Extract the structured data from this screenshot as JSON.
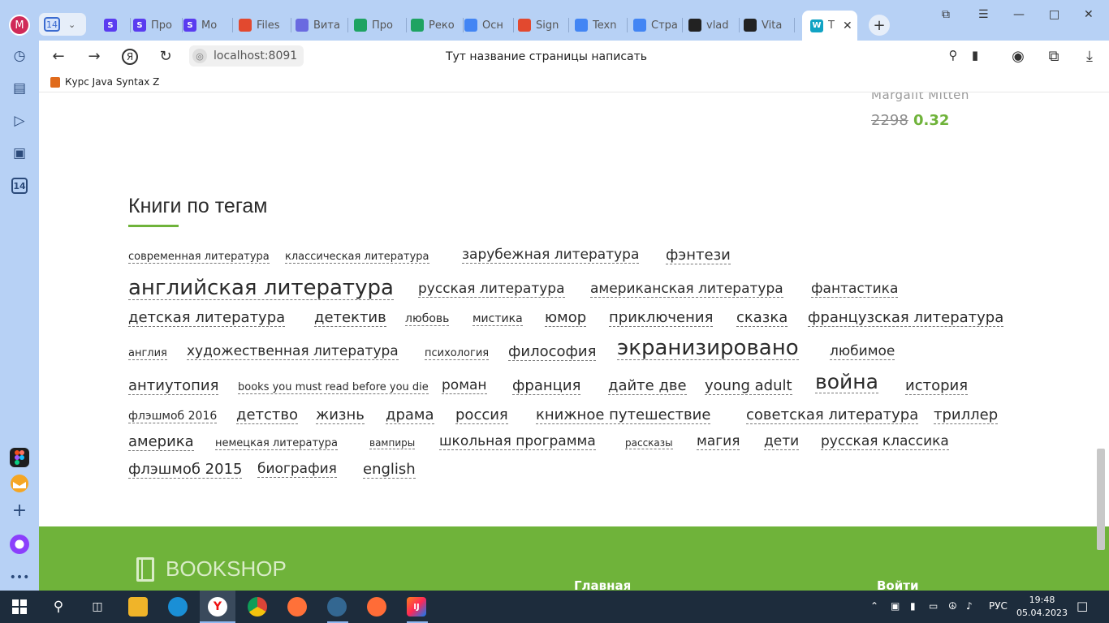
{
  "sidebar": {
    "profile_letter": "M",
    "badge": "14"
  },
  "tabs": {
    "group_count": "14",
    "items": [
      {
        "label": "",
        "icon_letter": "S",
        "color": "#5a3cf0"
      },
      {
        "label": "Про",
        "icon_letter": "S",
        "color": "#5a3cf0"
      },
      {
        "label": "Мо",
        "icon_letter": "S",
        "color": "#5a3cf0"
      },
      {
        "label": "Files",
        "icon_letter": "",
        "color": "#e2492f"
      },
      {
        "label": "Вита",
        "icon_letter": "",
        "color": "#6a6ae0"
      },
      {
        "label": "Про",
        "icon_letter": "",
        "color": "#1ea362"
      },
      {
        "label": "Реко",
        "icon_letter": "",
        "color": "#1ea362"
      },
      {
        "label": "Осн",
        "icon_letter": "",
        "color": "#4285f4"
      },
      {
        "label": "Sign",
        "icon_letter": "",
        "color": "#e2492f"
      },
      {
        "label": "Texn",
        "icon_letter": "",
        "color": "#4285f4"
      },
      {
        "label": "Стра",
        "icon_letter": "",
        "color": "#4285f4"
      },
      {
        "label": "vlad",
        "icon_letter": "",
        "color": "#222"
      },
      {
        "label": "Vita",
        "icon_letter": "",
        "color": "#222"
      }
    ],
    "active_label": "T",
    "active_icon": "W"
  },
  "nav": {
    "url": "localhost:8091",
    "title": "Тут название страницы написать"
  },
  "bookmarks": [
    {
      "label": "Курс Java Syntax Z"
    }
  ],
  "book": {
    "author": "Margalit Mitten",
    "old_price": "2298",
    "new_price": "0.32"
  },
  "section": {
    "title": "Книги по тегам"
  },
  "tags": [
    "современная литература",
    "классическая литература",
    "зарубежная литература",
    "фэнтези",
    "английская литература",
    "русская литература",
    "американская литература",
    "фантастика",
    "детская литература",
    "детектив",
    "любовь",
    "мистика",
    "юмор",
    "приключения",
    "сказка",
    "французская литература",
    "англия",
    "художественная литература",
    "психология",
    "философия",
    "экранизировано",
    "любимое",
    "антиутопия",
    "books you must read before you die",
    "роман",
    "франция",
    "дайте две",
    "young adult",
    "война",
    "история",
    "флэшмоб 2016",
    "детство",
    "жизнь",
    "драма",
    "россия",
    "книжное путешествие",
    "советская литература",
    "триллер",
    "америка",
    "немецкая литература",
    "вампиры",
    "школьная программа",
    "рассказы",
    "магия",
    "дети",
    "русская классика",
    "флэшмоб 2015",
    "биография",
    "english"
  ],
  "footer": {
    "logo": "BOOKSHOP",
    "link_main": "Главная",
    "link_login": "Войти"
  },
  "taskbar": {
    "lang": "РУС",
    "time": "19:48",
    "date": "05.04.2023"
  }
}
